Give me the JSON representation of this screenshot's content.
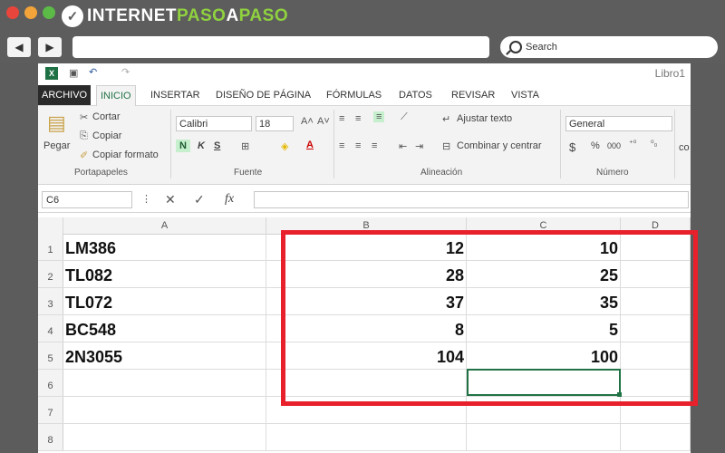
{
  "browser": {
    "logo": {
      "word1": "INTERNET",
      "word2": "PASO",
      "word3": "A",
      "word4": "PASO",
      "accent": "#8fd13f"
    },
    "search_placeholder": "Search",
    "back_icon": "triangle-left-icon",
    "forward_icon": "triangle-right-icon"
  },
  "excel": {
    "book_title": "Libro1",
    "tabs": [
      "ARCHIVO",
      "INICIO",
      "INSERTAR",
      "DISEÑO DE PÁGINA",
      "FÓRMULAS",
      "DATOS",
      "REVISAR",
      "VISTA"
    ],
    "clipboard": {
      "paste": "Pegar",
      "cut": "Cortar",
      "copy": "Copiar",
      "format": "Copiar formato",
      "group": "Portapapeles"
    },
    "font": {
      "name": "Calibri",
      "size": "18",
      "bold": "N",
      "italic": "K",
      "underline": "S",
      "group": "Fuente"
    },
    "alignment": {
      "wrap": "Ajustar texto",
      "merge": "Combinar y centrar",
      "group": "Alineación"
    },
    "number": {
      "format": "General",
      "currency": "$",
      "percent": "%",
      "thousands": "000",
      "group": "Número"
    },
    "overflow_label": "co",
    "name_box": "C6",
    "fx": "fx",
    "columns": [
      "A",
      "B",
      "C",
      "D"
    ],
    "rows": [
      {
        "n": "1",
        "a": "LM386",
        "b": "12",
        "c": "10"
      },
      {
        "n": "2",
        "a": "TL082",
        "b": "28",
        "c": "25"
      },
      {
        "n": "3",
        "a": "TL072",
        "b": "37",
        "c": "35"
      },
      {
        "n": "4",
        "a": "BC548",
        "b": "8",
        "c": "5"
      },
      {
        "n": "5",
        "a": "2N3055",
        "b": "104",
        "c": "100"
      },
      {
        "n": "6",
        "a": "",
        "b": "",
        "c": ""
      },
      {
        "n": "7",
        "a": "",
        "b": "",
        "c": ""
      },
      {
        "n": "8",
        "a": "",
        "b": "",
        "c": ""
      }
    ],
    "selected_cell": "C6",
    "highlight_color": "#e8202b",
    "accent": "#217346"
  }
}
